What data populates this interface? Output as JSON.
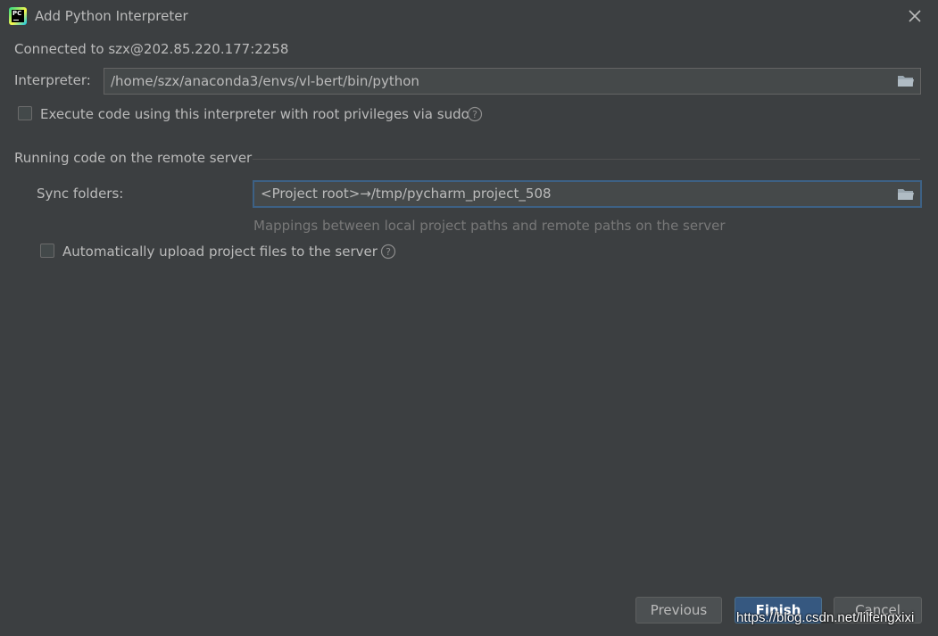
{
  "window": {
    "title": "Add Python Interpreter",
    "app_icon": "pycharm-icon",
    "app_icon_text": "PC"
  },
  "connection": {
    "text": "Connected to szx@202.85.220.177:2258"
  },
  "interpreter": {
    "label": "Interpreter:",
    "value": "/home/szx/anaconda3/envs/vl-bert/bin/python",
    "browse_icon": "folder-icon"
  },
  "sudo_option": {
    "label": "Execute code using this interpreter with root privileges via sudo",
    "checked": false,
    "help_icon": "help-icon"
  },
  "remote_section": {
    "title": "Running code on the remote server",
    "sync_folders": {
      "label": "Sync folders:",
      "value": "<Project root>→/tmp/pycharm_project_508",
      "browse_icon": "folder-icon"
    },
    "hint": "Mappings between local project paths and remote paths on the server",
    "auto_upload": {
      "label": "Automatically upload project files to the server",
      "checked": false,
      "help_icon": "help-icon"
    }
  },
  "buttons": {
    "previous": "Previous",
    "finish": "Finish",
    "cancel": "Cancel"
  },
  "watermark": "https://blog.csdn.net/lilfengxixi",
  "colors": {
    "background": "#3c3f41",
    "text": "#bbbbbb",
    "field_bg": "#45494a",
    "focus_border": "#3d6185",
    "primary_button": "#365880"
  }
}
